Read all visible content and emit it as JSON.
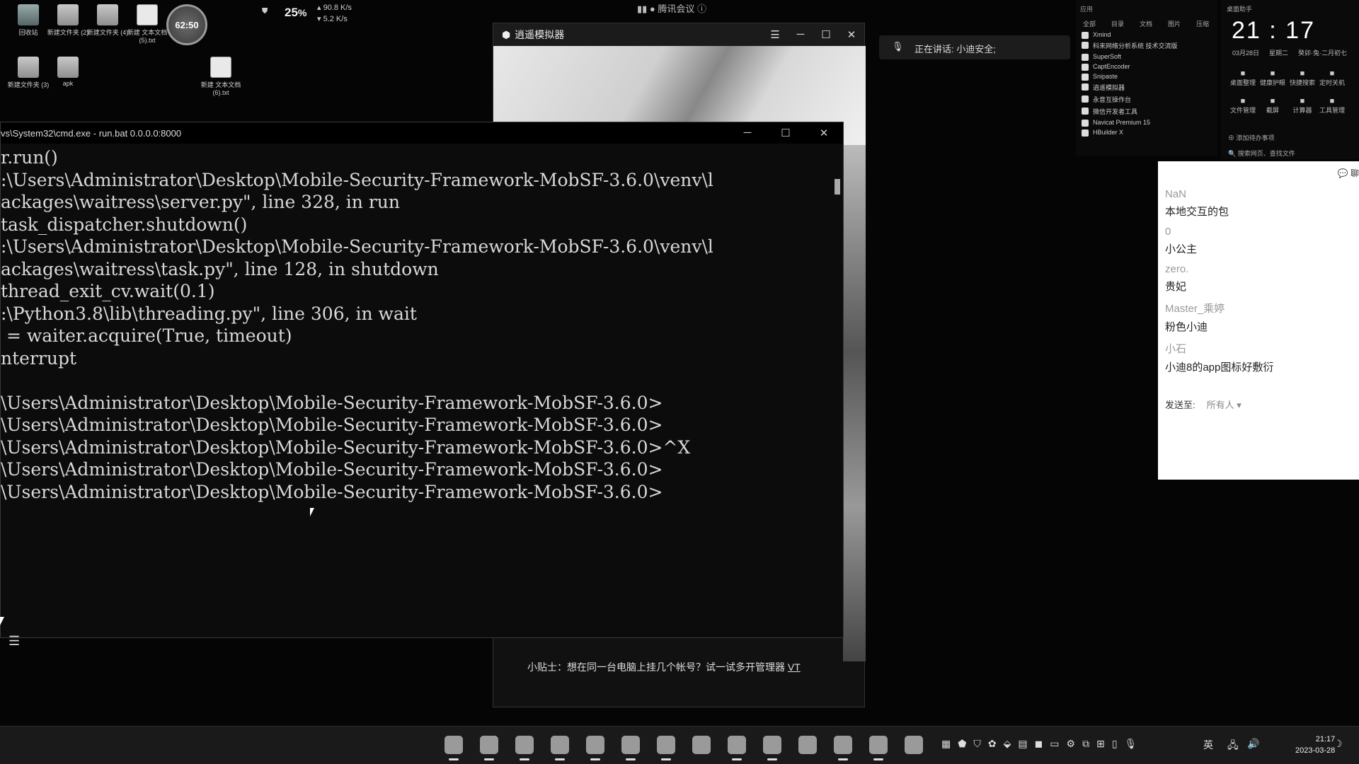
{
  "desktop": {
    "icons": [
      {
        "label": "回收站",
        "kind": "bin"
      },
      {
        "label": "新建文件夹 (2)",
        "kind": "folder"
      },
      {
        "label": "新建文件夹 (4)",
        "kind": "folder"
      },
      {
        "label": "新建 文本文档 (5).txt",
        "kind": "doc"
      },
      {
        "label": "新建文件夹 (3)",
        "kind": "folder"
      },
      {
        "label": "apk",
        "kind": "folder"
      },
      {
        "label": "新建 文本文档 (6).txt",
        "kind": "doc"
      }
    ],
    "timer": "62:50",
    "net": {
      "cpu_percent": "25",
      "cpu_unit": "%",
      "up": "90.8 K/s",
      "down": "5.2 K/s"
    }
  },
  "meeting": {
    "title": "腾讯会议",
    "speaking": "正在讲话: 小迪安全;"
  },
  "emulator": {
    "title": "逍遥模拟器",
    "tip": "小贴士：想在同一台电脑上挂几个帐号？试一试多开管理器",
    "tip_suffix": "VT"
  },
  "cmd": {
    "title": "vs\\System32\\cmd.exe - run.bat  0.0.0.0:8000",
    "lines": [
      "r.run()",
      ":\\Users\\Administrator\\Desktop\\Mobile-Security-Framework-MobSF-3.6.0\\venv\\l",
      "ackages\\waitress\\server.py\", line 328, in run",
      "task_dispatcher.shutdown()",
      ":\\Users\\Administrator\\Desktop\\Mobile-Security-Framework-MobSF-3.6.0\\venv\\l",
      "ackages\\waitress\\task.py\", line 128, in shutdown",
      "thread_exit_cv.wait(0.1)",
      ":\\Python3.8\\lib\\threading.py\", line 306, in wait",
      " = waiter.acquire(True, timeout)",
      "nterrupt",
      "",
      "\\Users\\Administrator\\Desktop\\Mobile-Security-Framework-MobSF-3.6.0>",
      "\\Users\\Administrator\\Desktop\\Mobile-Security-Framework-MobSF-3.6.0>",
      "\\Users\\Administrator\\Desktop\\Mobile-Security-Framework-MobSF-3.6.0>^X",
      "\\Users\\Administrator\\Desktop\\Mobile-Security-Framework-MobSF-3.6.0>",
      "\\Users\\Administrator\\Desktop\\Mobile-Security-Framework-MobSF-3.6.0>"
    ]
  },
  "launcher": {
    "header": "应用",
    "tabs": [
      "全部",
      "目录",
      "文档",
      "图片",
      "压缩"
    ],
    "apps": [
      "Xmind",
      "科来网络分析系统 技术交流版",
      "SuperSoft",
      "CaptEncoder",
      "Snipaste",
      "逍遥模拟器",
      "永音互操作台",
      "微信开发者工具",
      "Navicat Premium 15",
      "HBuilder X"
    ]
  },
  "clock": {
    "label": "桌面助手",
    "time": "21 : 17",
    "date": "03月28日",
    "weekday": "星期二",
    "lunar": "癸卯·兔·二月初七",
    "tools": [
      "桌面整理",
      "健康护眼",
      "快捷搜索",
      "定时关机",
      "文件管理",
      "截屏",
      "计算器",
      "工具管理"
    ],
    "todo": "添加待办事项",
    "search": "搜索网页、查找文件"
  },
  "chat": {
    "header": "聊",
    "messages": [
      {
        "name": "NaN",
        "text": "本地交互的包"
      },
      {
        "name": "0",
        "text": "小公主"
      },
      {
        "name": "zero.",
        "text": "贵妃"
      },
      {
        "name": "Master_乘婷",
        "text": "粉色小迪"
      },
      {
        "name": "小石",
        "text": "小迪8的app图标好敷衍"
      }
    ],
    "send_label": "发送至:",
    "send_to": "所有人 ▾"
  },
  "taskbar": {
    "tray_ime": "英",
    "time": "21:17",
    "date": "2023-03-28"
  }
}
